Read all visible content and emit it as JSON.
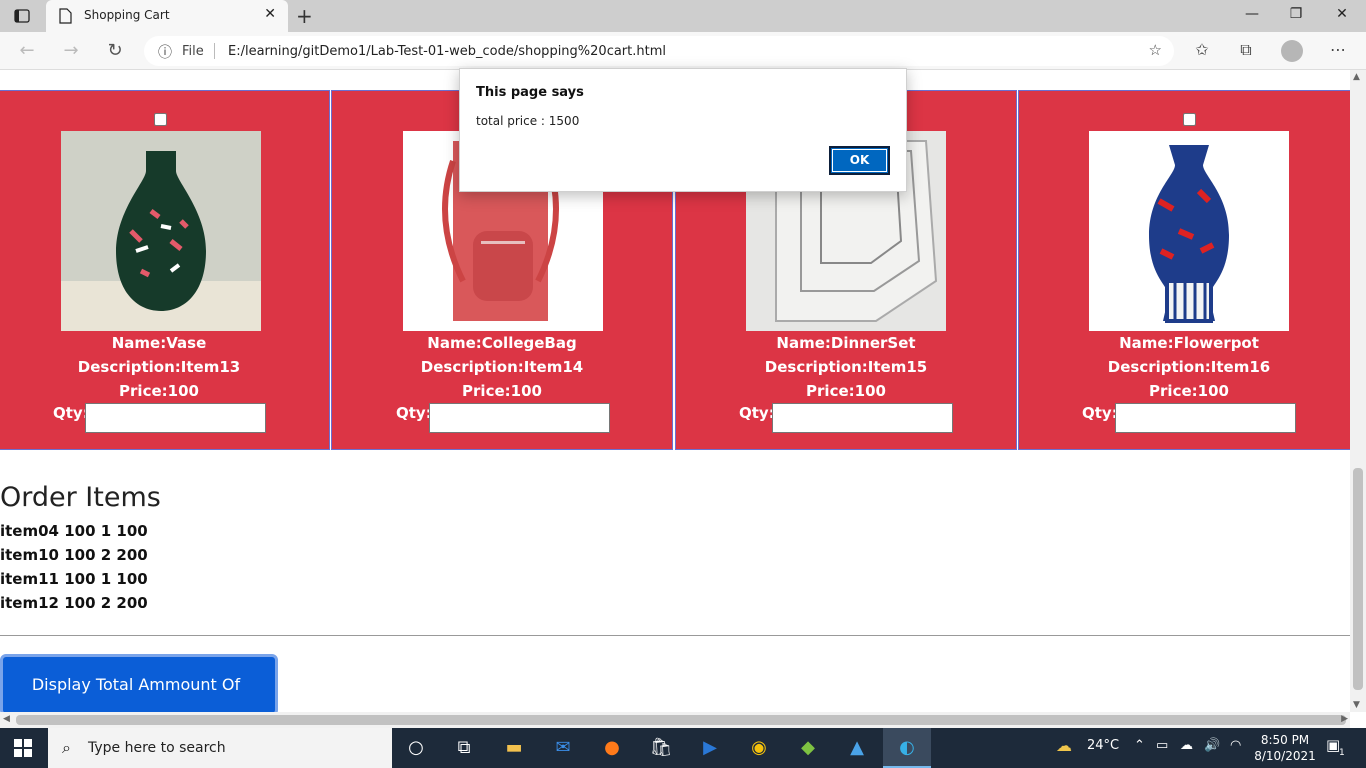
{
  "browser": {
    "tab_title": "Shopping Cart",
    "address_prefix": "File",
    "url": "E:/learning/gitDemo1/Lab-Test-01-web_code/shopping%20cart.html"
  },
  "products": [
    {
      "name": "Name:Vase",
      "description": "Description:Item13",
      "price": "Price:100",
      "qty_label": "Qty:",
      "qty_value": ""
    },
    {
      "name": "Name:CollegeBag",
      "description": "Description:Item14",
      "price": "Price:100",
      "qty_label": "Qty:",
      "qty_value": ""
    },
    {
      "name": "Name:DinnerSet",
      "description": "Description:Item15",
      "price": "Price:100",
      "qty_label": "Qty:",
      "qty_value": ""
    },
    {
      "name": "Name:Flowerpot",
      "description": "Description:Item16",
      "price": "Price:100",
      "qty_label": "Qty:",
      "qty_value": ""
    }
  ],
  "order": {
    "heading": "Order Items",
    "items": [
      "item04 100 1 100",
      "item10 100 2 200",
      "item11 100 1 100",
      "item12 100 2 200"
    ]
  },
  "total_button": "Display Total Ammount Of Shopping",
  "dialog": {
    "title": "This page says",
    "message": "total price : 1500",
    "ok_label": "OK"
  },
  "taskbar": {
    "search_placeholder": "Type here to search",
    "temperature": "24°C",
    "time": "8:50 PM",
    "date": "8/10/2021",
    "notification_count": "1"
  },
  "colors": {
    "card_bg": "#dc3545",
    "button_bg": "#0b5ed7",
    "dialog_ok": "#0067c0",
    "taskbar": "#1d2a3a"
  }
}
